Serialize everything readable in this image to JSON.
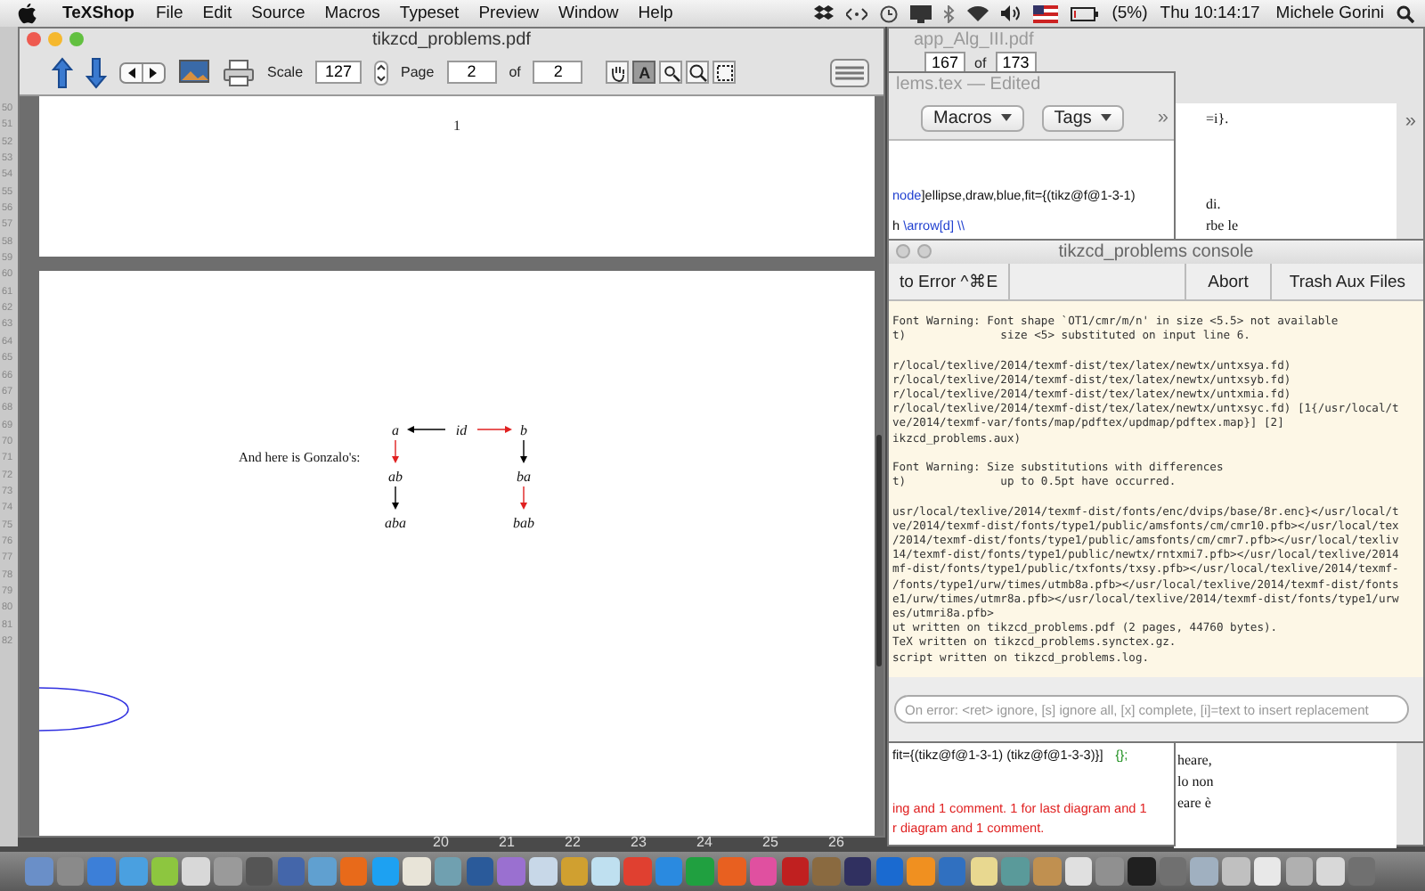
{
  "menu_bar": {
    "app": "TeXShop",
    "items": [
      "File",
      "Edit",
      "Source",
      "Macros",
      "Typeset",
      "Preview",
      "Window",
      "Help"
    ],
    "battery": "(5%)",
    "clock": "Thu 10:14:17",
    "user": "Michele Gorini"
  },
  "line_numbers": [
    "50",
    "51",
    "52",
    "53",
    "54",
    "55",
    "56",
    "57",
    "58",
    "59",
    "60",
    "61",
    "62",
    "63",
    "64",
    "65",
    "66",
    "67",
    "68",
    "69",
    "70",
    "71",
    "72",
    "73",
    "74",
    "75",
    "76",
    "77",
    "78",
    "79",
    "80",
    "81",
    "82"
  ],
  "app_window": {
    "title": "app_Alg_III.pdf",
    "page": "167",
    "of_label": "of",
    "page_count": "173",
    "chevron": "»",
    "text_top": [
      "=i}.",
      "di.",
      "rbe le"
    ],
    "text_bottom": [
      "heare,",
      "lo non",
      "eare è"
    ]
  },
  "editor_window": {
    "title": "lems.tex — Edited",
    "menus": [
      "Macros",
      "Tags"
    ],
    "chevron": "»",
    "code_top": [
      [
        {
          "kind": "command",
          "text": "node"
        },
        {
          "kind": "plain",
          "text": "]ellipse,draw,blue,fit={(tikz@f@1-3-1)"
        }
      ],
      [
        {
          "kind": "plain",
          "text": "h "
        },
        {
          "kind": "command",
          "text": "\\arrow[d] \\\\"
        }
      ]
    ],
    "code_bottom": [
      [
        {
          "kind": "plain",
          "text": "fit={(tikz@f@1-3-1) (tikz@f@1-3-3)}]"
        },
        {
          "kind": "brace",
          "text": "{};"
        }
      ],
      [
        {
          "kind": "comment",
          "text": "ing and 1 comment. 1 for last diagram and 1"
        }
      ],
      [
        {
          "kind": "comment",
          "text": "r diagram and 1 comment."
        }
      ]
    ]
  },
  "console": {
    "title": "tikzcd_problems console",
    "buttons": [
      "to Error ^⌘E",
      "Abort",
      "Trash Aux Files"
    ],
    "log": [
      [
        "Font Warning: Font shape `OT1/cmr/m/n' in size <5.5> not available",
        "t)              size <5> substituted on input line 6."
      ],
      [
        "r/local/texlive/2014/texmf-dist/tex/latex/newtx/untxsya.fd)",
        "r/local/texlive/2014/texmf-dist/tex/latex/newtx/untxsyb.fd)",
        "r/local/texlive/2014/texmf-dist/tex/latex/newtx/untxmia.fd)",
        "r/local/texlive/2014/texmf-dist/tex/latex/newtx/untxsyc.fd) [1{/usr/local/t",
        "ve/2014/texmf-var/fonts/map/pdftex/updmap/pdftex.map}] [2]",
        "ikzcd_problems.aux)"
      ],
      [
        "Font Warning: Size substitutions with differences",
        "t)              up to 0.5pt have occurred."
      ],
      [
        "usr/local/texlive/2014/texmf-dist/fonts/enc/dvips/base/8r.enc}</usr/local/t",
        "ve/2014/texmf-dist/fonts/type1/public/amsfonts/cm/cmr10.pfb></usr/local/tex",
        "/2014/texmf-dist/fonts/type1/public/amsfonts/cm/cmr7.pfb></usr/local/texliv",
        "14/texmf-dist/fonts/type1/public/newtx/rntxmi7.pfb></usr/local/texlive/2014",
        "mf-dist/fonts/type1/public/txfonts/txsy.pfb></usr/local/texlive/2014/texmf-",
        "/fonts/type1/urw/times/utmb8a.pfb></usr/local/texlive/2014/texmf-dist/fonts",
        "e1/urw/times/utmr8a.pfb></usr/local/texlive/2014/texmf-dist/fonts/type1/urw",
        "es/utmri8a.pfb>",
        "ut written on tikzcd_problems.pdf (2 pages, 44760 bytes).",
        "TeX written on tikzcd_problems.synctex.gz.",
        "script written on tikzcd_problems.log."
      ]
    ],
    "placeholder": "On error: <ret> ignore, [s] ignore all, [x] complete, [i]=text to insert replacement"
  },
  "pdf_window": {
    "title": "tikzcd_problems.pdf",
    "scale_label": "Scale",
    "scale": "127",
    "page_label": "Page",
    "page": "2",
    "of_label": "of",
    "page_count": "2",
    "tools": [
      {
        "kind": "hand",
        "selected": false
      },
      {
        "kind": "text",
        "label": "A",
        "selected": true
      },
      {
        "kind": "zoom-small",
        "selected": false
      },
      {
        "kind": "zoom",
        "selected": false
      },
      {
        "kind": "select",
        "selected": false
      }
    ],
    "page_number": "1",
    "text": "And here is Gonzalo's:",
    "diagram": {
      "nodes": [
        "a",
        "id",
        "b",
        "ab",
        "ba",
        "aba",
        "bab"
      ],
      "edges": [
        {
          "color": "#000000"
        },
        {
          "color": "#e02020"
        },
        {
          "color": "#e02020"
        },
        {
          "color": "#000000"
        },
        {
          "color": "#000000"
        },
        {
          "color": "#e02020"
        }
      ]
    }
  },
  "calendar_numbers": [
    "20",
    "21",
    "22",
    "23",
    "24",
    "25",
    "26"
  ]
}
